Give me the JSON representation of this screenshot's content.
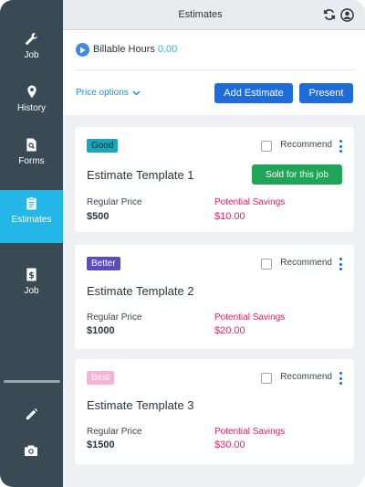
{
  "header": {
    "title": "Estimates",
    "icons": [
      "refresh-icon",
      "account-icon"
    ]
  },
  "sidebar": {
    "items": [
      {
        "label": "Job",
        "icon": "wrench-icon"
      },
      {
        "label": "History",
        "icon": "location-pin-icon"
      },
      {
        "label": "Forms",
        "icon": "form-search-icon"
      },
      {
        "label": "Estimates",
        "icon": "clipboard-icon",
        "active": true
      },
      {
        "label": "Job",
        "icon": "invoice-dollar-icon"
      }
    ],
    "tools": [
      "pencil-icon",
      "camera-icon"
    ]
  },
  "billable": {
    "label": "Billable Hours",
    "value": "0.00"
  },
  "price_options": {
    "label": "Price options"
  },
  "actions": {
    "add_estimate": "Add Estimate",
    "present": "Present"
  },
  "estimates": [
    {
      "tier": "Good",
      "tier_color": "#1ba5b8",
      "title": "Estimate Template 1",
      "recommend": "Recommend",
      "sold_label": "Sold for this job",
      "regular_price_label": "Regular Price",
      "regular_price": "$500",
      "savings_label": "Potential Savings",
      "savings": "$10.00"
    },
    {
      "tier": "Better",
      "tier_color": "#5b4bc4",
      "title": "Estimate Template 2",
      "recommend": "Recommend",
      "regular_price_label": "Regular Price",
      "regular_price": "$1000",
      "savings_label": "Potential Savings",
      "savings": "$20.00"
    },
    {
      "tier": "Best",
      "tier_color": "#f7b3d6",
      "title": "Estimate Template 3",
      "recommend": "Recommend",
      "regular_price_label": "Regular Price",
      "regular_price": "$1500",
      "savings_label": "Potential Savings",
      "savings": "$30.00"
    }
  ],
  "colors": {
    "sidebar": "#3a4a54",
    "active": "#24b6e6",
    "primary": "#1f6bdb",
    "success": "#22a35a",
    "savings": "#e0245e"
  }
}
